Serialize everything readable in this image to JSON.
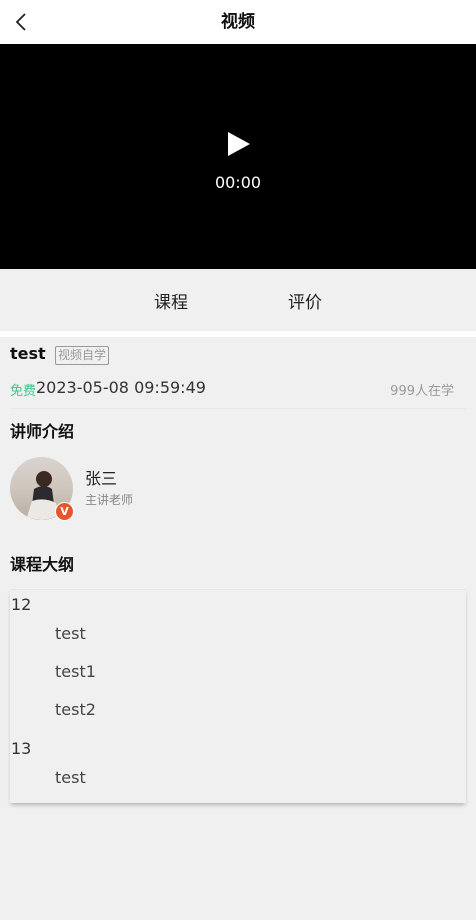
{
  "header": {
    "title": "视频"
  },
  "video": {
    "time": "00:00"
  },
  "tabs": [
    {
      "label": "课程"
    },
    {
      "label": "评价"
    }
  ],
  "course": {
    "name": "test",
    "tag": "视频自学",
    "free_label": "免费",
    "date": "2023-05-08 09:59:49",
    "learners": "999人在学"
  },
  "teacher_section": {
    "title": "讲师介绍"
  },
  "teacher": {
    "name": "张三",
    "role": "主讲老师",
    "badge": "V"
  },
  "outline": {
    "title": "课程大纲",
    "chapters": [
      {
        "title": "12",
        "lessons": [
          "test",
          "test1",
          "test2"
        ]
      },
      {
        "title": "13",
        "lessons": [
          "test"
        ]
      }
    ]
  }
}
